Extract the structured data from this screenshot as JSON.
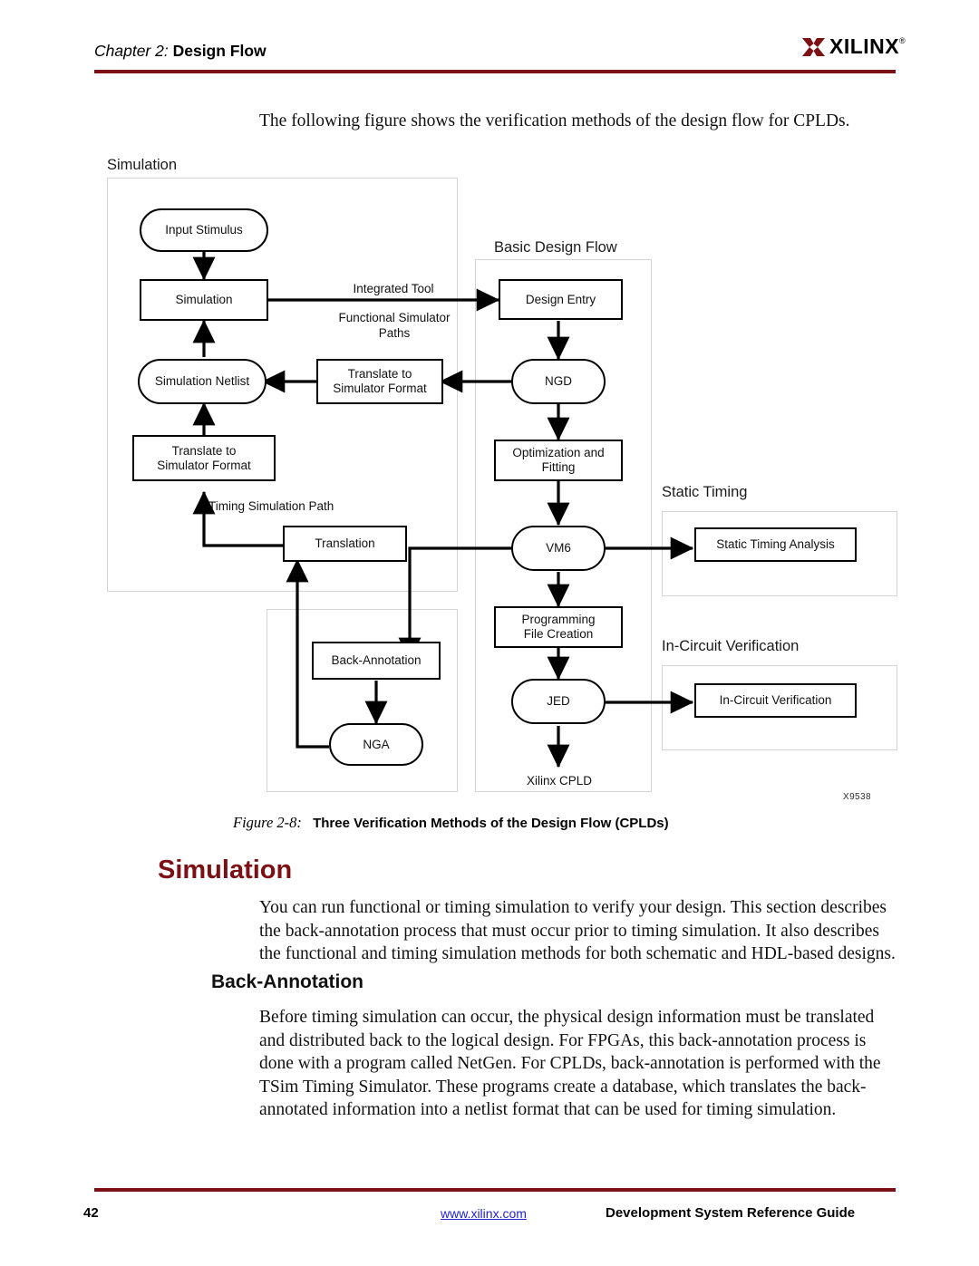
{
  "header": {
    "chapter_prefix": "Chapter 2:",
    "chapter_title": "Design Flow",
    "logo_text": "XILINX",
    "logo_registered": "®",
    "rule_color": "#7c1014"
  },
  "intro": {
    "paragraph": "The following figure shows the verification methods of the design flow for CPLDs."
  },
  "figure": {
    "group_labels": {
      "simulation": "Simulation",
      "basic_design_flow": "Basic Design Flow",
      "static_timing": "Static Timing",
      "in_circuit_verification": "In-Circuit Verification"
    },
    "nodes": {
      "input_stimulus": "Input Stimulus",
      "simulation": "Simulation",
      "simulation_netlist": "Simulation Netlist",
      "translate_to_simulator_format_mid": "Translate to\nSimulator Format",
      "translate_to_simulator_format_left": "Translate to\nSimulator Format",
      "translation": "Translation",
      "back_annotation": "Back-Annotation",
      "nga": "NGA",
      "design_entry": "Design Entry",
      "ngd": "NGD",
      "optimization_and_fitting": "Optimization and\nFitting",
      "vm6": "VM6",
      "programming_file_creation": "Programming\nFile Creation",
      "jed": "JED",
      "xilinx_cpld": "Xilinx CPLD",
      "static_timing_analysis": "Static Timing Analysis",
      "in_circuit_verification": "In-Circuit Verification"
    },
    "edge_labels": {
      "integrated_tool": "Integrated Tool",
      "functional_simulator_paths": "Functional Simulator\nPaths",
      "timing_simulation_path": "Timing Simulation Path"
    },
    "figure_code": "X9538",
    "caption_number": "Figure 2-8:",
    "caption_text": "Three Verification Methods of the Design Flow (CPLDs)"
  },
  "sections": {
    "simulation_heading": "Simulation",
    "simulation_body": "You can run functional or timing simulation to verify your design. This section describes the back-annotation process that must occur prior to timing simulation. It also describes the functional and timing simulation methods for both schematic and HDL-based designs.",
    "back_annotation_heading": "Back-Annotation",
    "back_annotation_body": "Before timing simulation can occur, the physical design information must be translated and distributed back to the logical design. For FPGAs, this back-annotation process is done with a program called NetGen. For CPLDs, back-annotation is performed with the TSim Timing Simulator. These programs create a database, which translates the back-annotated information into a netlist format that can be used for timing simulation."
  },
  "footer": {
    "page_number": "42",
    "url": "www.xilinx.com",
    "guide_title": "Development System Reference Guide"
  }
}
